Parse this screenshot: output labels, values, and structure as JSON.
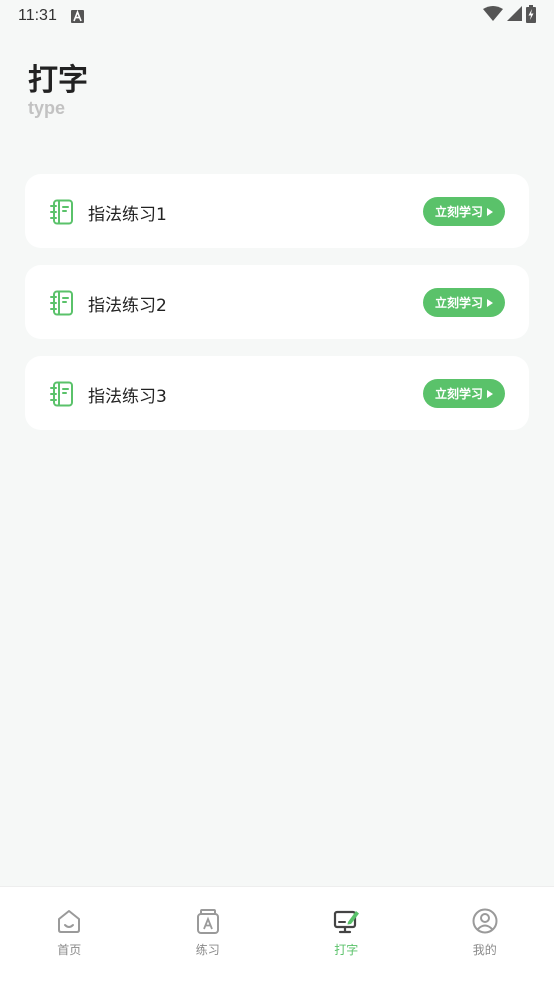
{
  "status_bar": {
    "time": "11:31",
    "icons": [
      "notification-a-icon",
      "wifi-icon",
      "signal-icon",
      "battery-charging-icon"
    ]
  },
  "header": {
    "title": "打字",
    "subtitle": "type"
  },
  "lessons": [
    {
      "label": "指法练习1",
      "button": "立刻学习",
      "icon": "notebook-icon"
    },
    {
      "label": "指法练习2",
      "button": "立刻学习",
      "icon": "notebook-icon"
    },
    {
      "label": "指法练习3",
      "button": "立刻学习",
      "icon": "notebook-icon"
    }
  ],
  "bottom_nav": {
    "items": [
      {
        "label": "首页",
        "icon": "home-icon",
        "active": false
      },
      {
        "label": "练习",
        "icon": "practice-book-icon",
        "active": false
      },
      {
        "label": "打字",
        "icon": "typing-monitor-icon",
        "active": true
      },
      {
        "label": "我的",
        "icon": "profile-icon",
        "active": false
      }
    ]
  },
  "colors": {
    "accent": "#5ac26a",
    "background": "#f6f8f7",
    "card": "#ffffff",
    "muted_text": "#8a8a8a"
  }
}
